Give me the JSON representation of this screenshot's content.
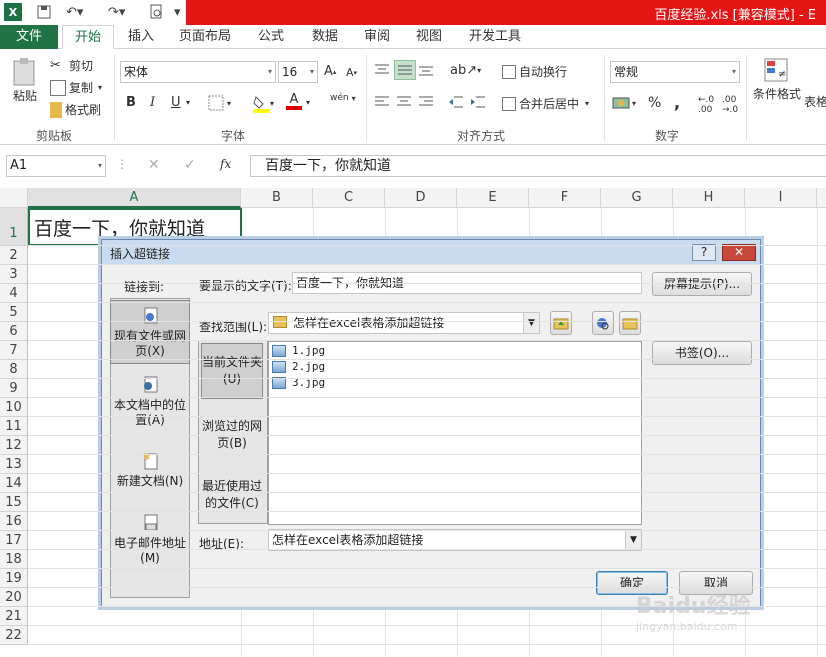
{
  "window": {
    "title": "百度经验.xls  [兼容模式] - E",
    "app_icon": "excel-icon"
  },
  "tabs": [
    "文件",
    "开始",
    "插入",
    "页面布局",
    "公式",
    "数据",
    "审阅",
    "视图",
    "开发工具"
  ],
  "ribbon": {
    "clipboard": {
      "paste": "粘贴",
      "cut": "剪切",
      "copy": "复制",
      "format_painter": "格式刷",
      "label": "剪贴板"
    },
    "font": {
      "name": "宋体",
      "size": "16",
      "bold": "B",
      "italic": "I",
      "underline": "U",
      "font_color": "A",
      "phonetic": "wén",
      "label": "字体"
    },
    "alignment": {
      "wrap": "自动换行",
      "merge": "合并后居中",
      "label": "对齐方式"
    },
    "number": {
      "format": "常规",
      "percent": "%",
      "comma": ",",
      "label": "数字"
    },
    "styles": {
      "conditional": "条件格式",
      "table": "表格"
    }
  },
  "formula_bar": {
    "name_box": "A1",
    "fx": "fx",
    "content": "百度一下，你就知道"
  },
  "grid": {
    "columns": [
      "A",
      "B",
      "C",
      "D",
      "E",
      "F",
      "G",
      "H",
      "I"
    ],
    "rows": [
      "1",
      "2",
      "3",
      "4",
      "5",
      "6",
      "7",
      "8",
      "9",
      "10",
      "11",
      "12",
      "13",
      "14",
      "15",
      "16",
      "17",
      "18",
      "19",
      "20",
      "21",
      "22"
    ],
    "cell_a1": "百度一下，你就知道"
  },
  "dialog": {
    "title": "插入超链接",
    "help": "?",
    "link_to_label": "链接到:",
    "link_options": [
      "现有文件或网页(X)",
      "本文档中的位置(A)",
      "新建文档(N)",
      "电子邮件地址(M)"
    ],
    "display_text_label": "要显示的文字(T):",
    "display_text_value": "百度一下，你就知道",
    "screen_tip_button": "屏幕提示(P)...",
    "look_in_label": "查找范围(L):",
    "look_in_value": "怎样在excel表格添加超链接",
    "nav_items": [
      "当前文件夹(U)",
      "浏览过的网页(B)",
      "最近使用过的文件(C)"
    ],
    "files": [
      "1.jpg",
      "2.jpg",
      "3.jpg"
    ],
    "bookmark_button": "书签(O)...",
    "address_label": "地址(E):",
    "address_value": "怎样在excel表格添加超链接",
    "ok_button": "确定",
    "cancel_button": "取消"
  },
  "watermark": "Baidu经验 jingyan.baidu.com"
}
